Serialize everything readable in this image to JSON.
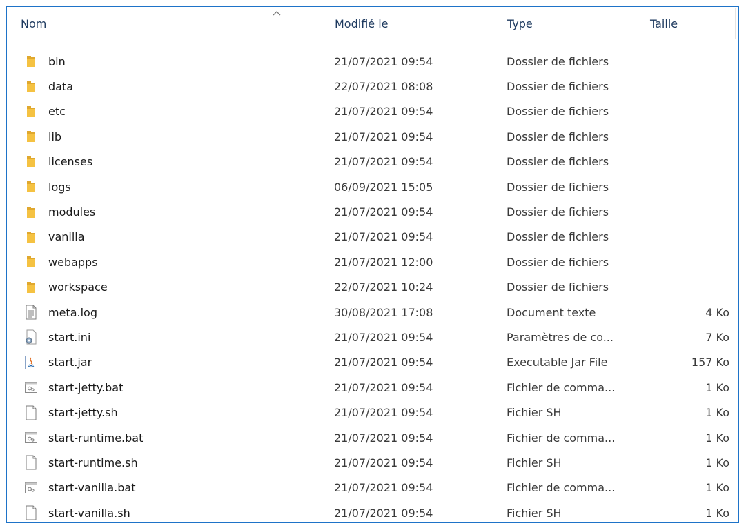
{
  "columns": {
    "name": "Nom",
    "modified": "Modifié le",
    "type": "Type",
    "size": "Taille"
  },
  "colors": {
    "frame_border": "#1e73c8",
    "folder": "#f5c242",
    "header_text": "#1e3a5f"
  },
  "files": [
    {
      "name": "bin",
      "modified": "21/07/2021 09:54",
      "type": "Dossier de fichiers",
      "size": "",
      "icon": "folder-icon"
    },
    {
      "name": "data",
      "modified": "22/07/2021 08:08",
      "type": "Dossier de fichiers",
      "size": "",
      "icon": "folder-icon"
    },
    {
      "name": "etc",
      "modified": "21/07/2021 09:54",
      "type": "Dossier de fichiers",
      "size": "",
      "icon": "folder-icon"
    },
    {
      "name": "lib",
      "modified": "21/07/2021 09:54",
      "type": "Dossier de fichiers",
      "size": "",
      "icon": "folder-icon"
    },
    {
      "name": "licenses",
      "modified": "21/07/2021 09:54",
      "type": "Dossier de fichiers",
      "size": "",
      "icon": "folder-icon"
    },
    {
      "name": "logs",
      "modified": "06/09/2021 15:05",
      "type": "Dossier de fichiers",
      "size": "",
      "icon": "folder-icon"
    },
    {
      "name": "modules",
      "modified": "21/07/2021 09:54",
      "type": "Dossier de fichiers",
      "size": "",
      "icon": "folder-icon"
    },
    {
      "name": "vanilla",
      "modified": "21/07/2021 09:54",
      "type": "Dossier de fichiers",
      "size": "",
      "icon": "folder-icon"
    },
    {
      "name": "webapps",
      "modified": "21/07/2021 12:00",
      "type": "Dossier de fichiers",
      "size": "",
      "icon": "folder-icon"
    },
    {
      "name": "workspace",
      "modified": "22/07/2021 10:24",
      "type": "Dossier de fichiers",
      "size": "",
      "icon": "folder-icon"
    },
    {
      "name": "meta.log",
      "modified": "30/08/2021 17:08",
      "type": "Document texte",
      "size": "4 Ko",
      "icon": "text-document-icon"
    },
    {
      "name": "start.ini",
      "modified": "21/07/2021 09:54",
      "type": "Paramètres de co...",
      "size": "7 Ko",
      "icon": "settings-file-icon"
    },
    {
      "name": "start.jar",
      "modified": "21/07/2021 09:54",
      "type": "Executable Jar File",
      "size": "157 Ko",
      "icon": "java-jar-icon"
    },
    {
      "name": "start-jetty.bat",
      "modified": "21/07/2021 09:54",
      "type": "Fichier de comma...",
      "size": "1 Ko",
      "icon": "batch-file-icon"
    },
    {
      "name": "start-jetty.sh",
      "modified": "21/07/2021 09:54",
      "type": "Fichier SH",
      "size": "1 Ko",
      "icon": "blank-file-icon"
    },
    {
      "name": "start-runtime.bat",
      "modified": "21/07/2021 09:54",
      "type": "Fichier de comma...",
      "size": "1 Ko",
      "icon": "batch-file-icon"
    },
    {
      "name": "start-runtime.sh",
      "modified": "21/07/2021 09:54",
      "type": "Fichier SH",
      "size": "1 Ko",
      "icon": "blank-file-icon"
    },
    {
      "name": "start-vanilla.bat",
      "modified": "21/07/2021 09:54",
      "type": "Fichier de comma...",
      "size": "1 Ko",
      "icon": "batch-file-icon"
    },
    {
      "name": "start-vanilla.sh",
      "modified": "21/07/2021 09:54",
      "type": "Fichier SH",
      "size": "1 Ko",
      "icon": "blank-file-icon"
    }
  ]
}
